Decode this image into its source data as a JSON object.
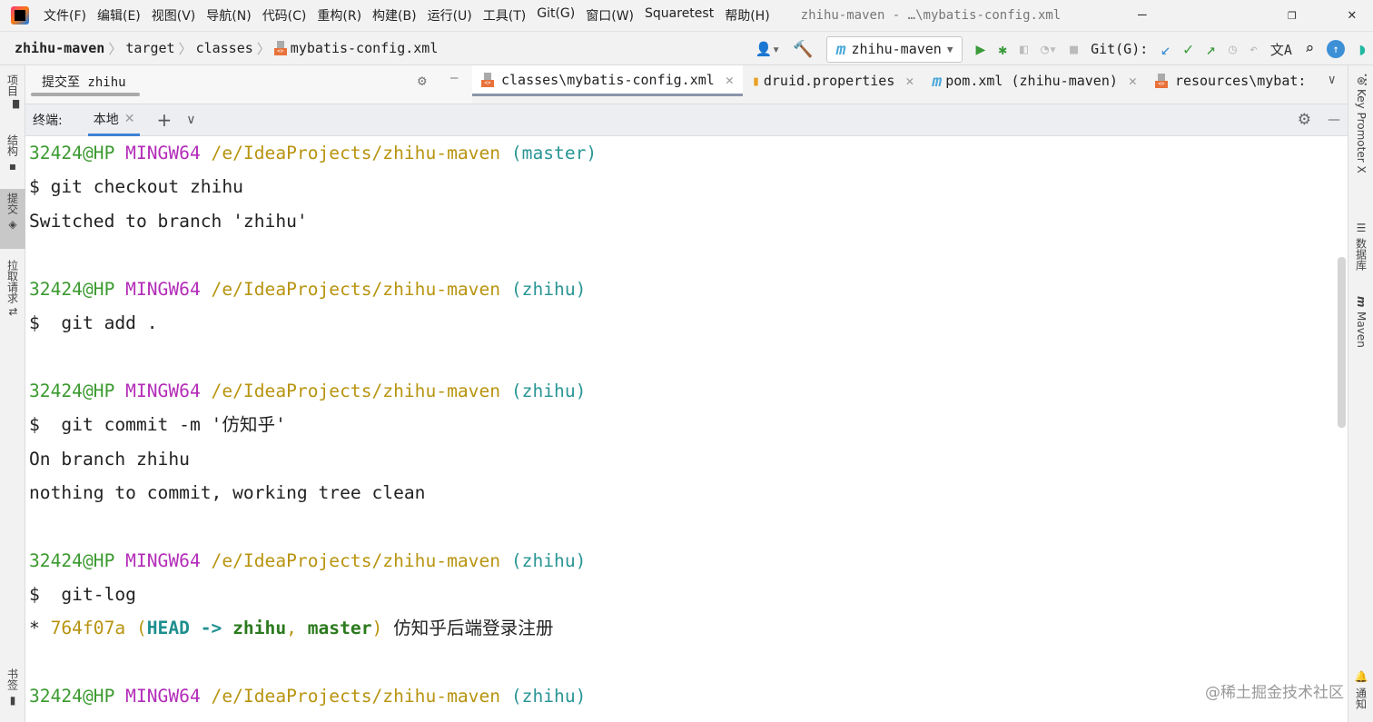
{
  "titlebar": {
    "menus": [
      "文件(F)",
      "编辑(E)",
      "视图(V)",
      "导航(N)",
      "代码(C)",
      "重构(R)",
      "构建(B)",
      "运行(U)",
      "工具(T)",
      "Git(G)",
      "窗口(W)",
      "Squaretest",
      "帮助(H)"
    ],
    "title": "zhihu-maven - …\\mybatis-config.xml"
  },
  "breadcrumb": [
    "zhihu-maven",
    "target",
    "classes",
    "mybatis-config.xml"
  ],
  "toolbar": {
    "run_config": "zhihu-maven",
    "git_label": "Git(G):"
  },
  "commit_pane": {
    "label": "提交至 zhihu"
  },
  "editor_tabs": [
    "classes\\mybatis-config.xml",
    "druid.properties",
    "pom.xml (zhihu-maven)",
    "resources\\mybat:"
  ],
  "terminal": {
    "label": "终端:",
    "tab": "本地"
  },
  "left_strip": [
    "项目",
    "结构",
    "提交",
    "拉取请求",
    "书签"
  ],
  "right_strip": [
    "Key Promoter X",
    "数据库",
    "Maven",
    "通知"
  ],
  "colors": {
    "user": "#3b9a2f",
    "system": "#b32cb8",
    "path": "#b89410",
    "branch": "#2a9595",
    "hash": "#b89410"
  },
  "lines": [
    [
      [
        "32424@HP ",
        "user"
      ],
      [
        "MINGW64 ",
        "system"
      ],
      [
        "/e/IdeaProjects/zhihu-maven ",
        "path"
      ],
      [
        "(master)",
        "branch"
      ]
    ],
    [
      [
        "$ git checkout zhihu",
        ""
      ]
    ],
    [
      [
        "Switched to branch 'zhihu'",
        ""
      ]
    ],
    [],
    [
      [
        "32424@HP ",
        "user"
      ],
      [
        "MINGW64 ",
        "system"
      ],
      [
        "/e/IdeaProjects/zhihu-maven ",
        "path"
      ],
      [
        "(zhihu)",
        "branch"
      ]
    ],
    [
      [
        "$  git add .",
        ""
      ]
    ],
    [],
    [
      [
        "32424@HP ",
        "user"
      ],
      [
        "MINGW64 ",
        "system"
      ],
      [
        "/e/IdeaProjects/zhihu-maven ",
        "path"
      ],
      [
        "(zhihu)",
        "branch"
      ]
    ],
    [
      [
        "$  git commit -m '仿知乎'",
        ""
      ]
    ],
    [
      [
        "On branch zhihu",
        ""
      ]
    ],
    [
      [
        "nothing to commit, working tree clean",
        ""
      ]
    ],
    [],
    [
      [
        "32424@HP ",
        "user"
      ],
      [
        "MINGW64 ",
        "system"
      ],
      [
        "/e/IdeaProjects/zhihu-maven ",
        "path"
      ],
      [
        "(zhihu)",
        "branch"
      ]
    ],
    [
      [
        "$  git-log",
        ""
      ]
    ],
    [
      [
        "* ",
        ""
      ],
      [
        "764f07a ",
        "hash"
      ],
      [
        "(",
        "hash"
      ],
      [
        "HEAD -> ",
        "headb"
      ],
      [
        "zhihu",
        "greenb"
      ],
      [
        ", ",
        "hash"
      ],
      [
        "master",
        "greenb"
      ],
      [
        ")",
        "hash"
      ],
      [
        " 仿知乎后端登录注册",
        ""
      ]
    ],
    [],
    [
      [
        "32424@HP ",
        "user"
      ],
      [
        "MINGW64 ",
        "system"
      ],
      [
        "/e/IdeaProjects/zhihu-maven ",
        "path"
      ],
      [
        "(zhihu)",
        "branch"
      ]
    ]
  ],
  "watermark": "@稀土掘金技术社区"
}
